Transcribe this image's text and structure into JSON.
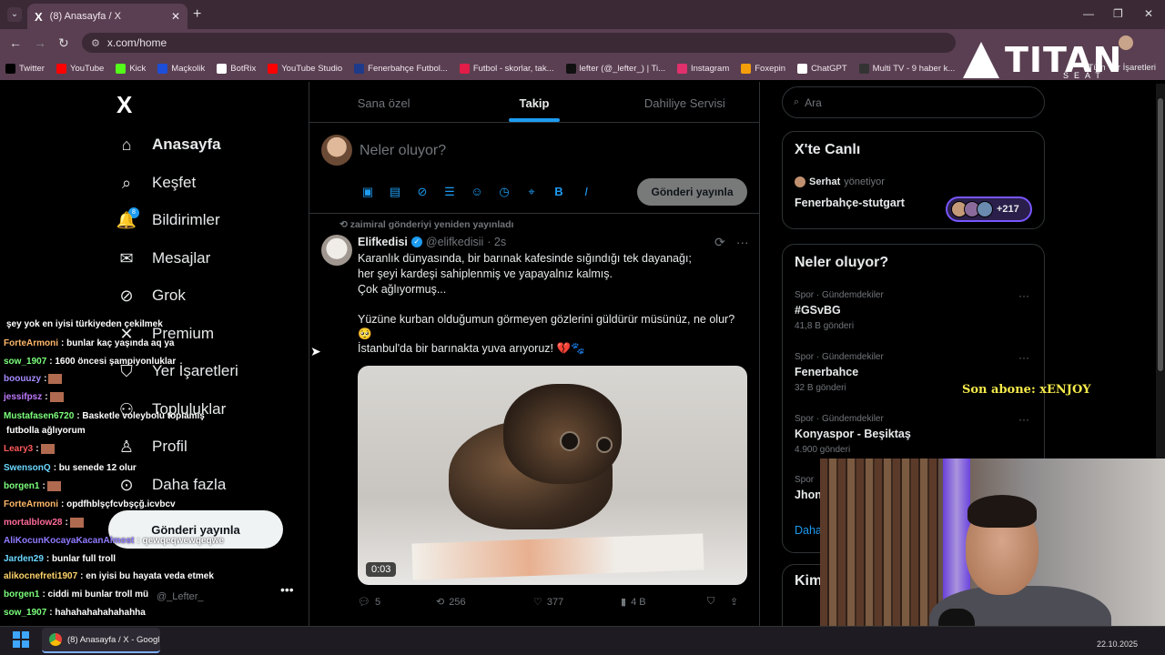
{
  "browser": {
    "tab_title": "(8) Anasayfa / X",
    "tab_icon": "X",
    "url": "x.com/home",
    "bookmarks": [
      {
        "label": "Twitter",
        "color": "#000000"
      },
      {
        "label": "YouTube",
        "color": "#ff0000"
      },
      {
        "label": "Kick",
        "color": "#53fc18"
      },
      {
        "label": "Maçkolik",
        "color": "#1d4ed8"
      },
      {
        "label": "BotRix",
        "color": "#ffffff"
      },
      {
        "label": "YouTube Studio",
        "color": "#ff0000"
      },
      {
        "label": "Fenerbahçe Futbol...",
        "color": "#1e3a8a"
      },
      {
        "label": "Futbol - skorlar, tak...",
        "color": "#e11d48"
      },
      {
        "label": "lefter (@_lefter_) | Ti...",
        "color": "#111111"
      },
      {
        "label": "Instagram",
        "color": "#e1306c"
      },
      {
        "label": "Foxepin",
        "color": "#f59e0b"
      },
      {
        "label": "ChatGPT",
        "color": "#ffffff"
      },
      {
        "label": "Multi TV - 9 haber k...",
        "color": "#333333"
      }
    ],
    "bookmarks_all": "Tüm Yer İşaretleri"
  },
  "nav": {
    "logo": "X",
    "items": [
      {
        "label": "Anasayfa",
        "icon": "home-icon",
        "glyph": "⌂"
      },
      {
        "label": "Keşfet",
        "icon": "search-icon",
        "glyph": "⌕"
      },
      {
        "label": "Bildirimler",
        "icon": "bell-icon",
        "glyph": "🔔"
      },
      {
        "label": "Mesajlar",
        "icon": "mail-icon",
        "glyph": "✉"
      },
      {
        "label": "Grok",
        "icon": "grok-icon",
        "glyph": "⊘"
      },
      {
        "label": "Premium",
        "icon": "x-icon",
        "glyph": "✕"
      },
      {
        "label": "Yer İşaretleri",
        "icon": "bookmark-icon",
        "glyph": "⛉"
      },
      {
        "label": "Topluluklar",
        "icon": "communities-icon",
        "glyph": "⚇"
      },
      {
        "label": "Profil",
        "icon": "profile-icon",
        "glyph": "♙"
      },
      {
        "label": "Daha fazla",
        "icon": "more-circle-icon",
        "glyph": "⊙"
      }
    ],
    "notifications_badge": "8",
    "post_button": "Gönderi yayınla",
    "account_handle": "@_Lefter_",
    "account_more": "•••"
  },
  "feed": {
    "tabs": [
      "Sana özel",
      "Takip",
      "Dahiliye Servisi"
    ],
    "active_tab": 1,
    "compose_placeholder": "Neler oluyor?",
    "compose_button": "Gönderi yayınla",
    "compose_icons": [
      "image-icon",
      "gif-icon",
      "grok-icon",
      "poll-icon",
      "emoji-icon",
      "schedule-icon",
      "location-icon",
      "bold-icon",
      "italic-icon"
    ],
    "post": {
      "repost_note": "zaimiral gönderiyi yeniden yayınladı",
      "name": "Elifkedisi",
      "handle": "@elifkedisii",
      "time": "· 2s",
      "lines": [
        "Karanlık dünyasında, bir barınak kafesinde sığındığı tek dayanağı;",
        "her şeyi kardeşi sahiplenmiş ve yapayalnız kalmış.",
        "Çok ağlıyormuş...",
        "Yüzüne kurban olduğumun görmeyen gözlerini güldürür müsünüz, ne olur?",
        "🥺",
        "İstanbul'da bir barınakta yuva arıyoruz! 💔🐾"
      ],
      "video_duration": "0:03",
      "stats": {
        "replies": "5",
        "reposts": "256",
        "likes": "377",
        "views": "4 B"
      }
    }
  },
  "sidebar": {
    "search_placeholder": "Ara",
    "live": {
      "title": "X'te Canlı",
      "host": "Serhat",
      "host_suffix": "yönetiyor",
      "topic": "Fenerbahçe-stutgart",
      "count": "+217"
    },
    "trends_title": "Neler oluyor?",
    "trends": [
      {
        "category": "Spor · Gündemdekiler",
        "name": "#GSvBG",
        "count": "41,8 B gönderi"
      },
      {
        "category": "Spor · Gündemdekiler",
        "name": "Fenerbahce",
        "count": "32 B gönderi"
      },
      {
        "category": "Spor · Gündemdekiler",
        "name": "Konyaspor - Beşiktaş",
        "count": "4.900 gönderi"
      },
      {
        "category": "Spor",
        "name": "Jhon",
        "count": ""
      }
    ],
    "show_more": "Daha",
    "who_to_follow": "Kim"
  },
  "overlay": {
    "logo_text": "TITAN",
    "logo_sub": "SEAT",
    "last_sub": "Son abone: xENJOY",
    "chat": [
      {
        "user": "",
        "msg": "şey yok en iyisi türkiyeden çekilmek",
        "color": "#ffffff"
      },
      {
        "user": "ForteArmoni",
        "msg": ": bunlar kaç yaşında aq ya",
        "color": "#ffb86b"
      },
      {
        "user": "sow_1907",
        "msg": ": 1600 öncesi şampiyonluklar",
        "color": "#7cff7c"
      },
      {
        "user": "boouuzy",
        "msg": ":",
        "color": "#a58bff",
        "emote": true
      },
      {
        "user": "jessifpsz",
        "msg": ":",
        "color": "#c07bff",
        "emote": true
      },
      {
        "user": "Mustafasen6720",
        "msg": ": Basketle voleybolu toplamış",
        "color": "#7cff7c"
      },
      {
        "user": "",
        "msg": "futbolla ağlıyorum",
        "color": "#ffffff"
      },
      {
        "user": "Leary3",
        "msg": ":",
        "color": "#ff5a5a",
        "emote": true
      },
      {
        "user": "SwensonQ",
        "msg": ": bu senede 12 olur",
        "color": "#6ad7ff"
      },
      {
        "user": "borgen1",
        "msg": ":",
        "color": "#7cff7c",
        "emote": true
      },
      {
        "user": "ForteArmoni",
        "msg": ": opdfhblşçfcvbşçğ.icvbcv",
        "color": "#ffb86b"
      },
      {
        "user": "mortalblow28",
        "msg": ":",
        "color": "#ff6b9a",
        "emote": true
      },
      {
        "user": "AliKocunKocayaKacanAlmost",
        "msg": ": qewqeqwewqeqwe",
        "color": "#8f7bff"
      },
      {
        "user": "Jarden29",
        "msg": ": bunlar full troll",
        "color": "#6ad7ff"
      },
      {
        "user": "alikocnefreti1907",
        "msg": ": en iyisi bu hayata veda etmek",
        "color": "#ffd36b"
      },
      {
        "user": "borgen1",
        "msg": ": ciddi mi bunlar troll mü",
        "color": "#7cff7c"
      },
      {
        "user": "sow_1907",
        "msg": ": hahahahahahahahha",
        "color": "#7cff7c"
      }
    ]
  },
  "taskbar": {
    "item": "(8) Anasayfa / X - Googl",
    "clock": "22.10.2025"
  }
}
